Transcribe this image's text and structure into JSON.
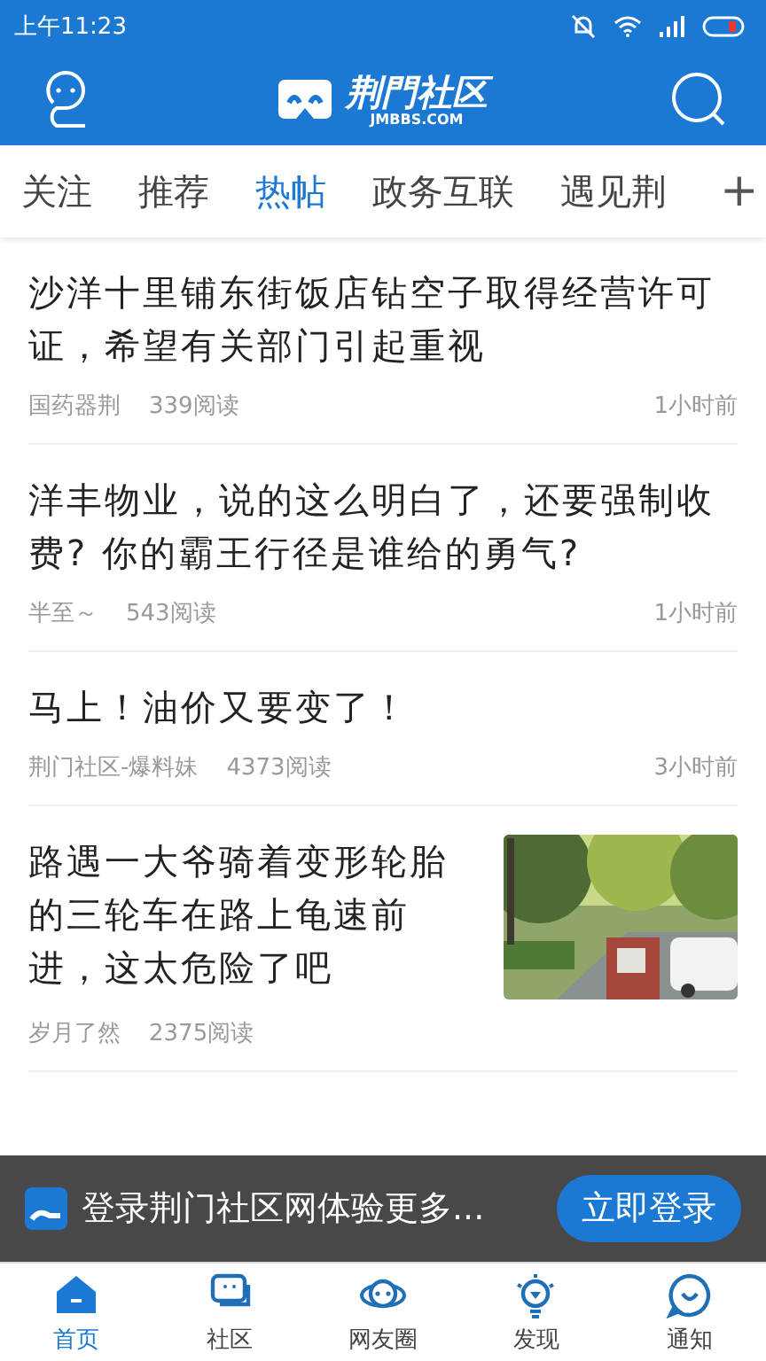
{
  "status_bar": {
    "time": "上午11:23"
  },
  "header": {
    "logo_title": "荆門社区",
    "logo_domain": "JMBBS.COM"
  },
  "tabs": [
    {
      "label": "关注",
      "selected": false
    },
    {
      "label": "推荐",
      "selected": false
    },
    {
      "label": "热帖",
      "selected": true
    },
    {
      "label": "政务互联",
      "selected": false
    },
    {
      "label": "遇见荆",
      "selected": false
    }
  ],
  "add_tab": "+",
  "posts": [
    {
      "kind": "text",
      "title": "沙洋十里铺东街饭店钻空子取得经营许可证，希望有关部门引起重视",
      "author": "国药器荆",
      "reads": "339阅读",
      "time": "1小时前"
    },
    {
      "kind": "text",
      "title": "洋丰物业，说的这么明白了，还要强制收费? 你的霸王行径是谁给的勇气?",
      "author": "半至～",
      "reads": "543阅读",
      "time": "1小时前"
    },
    {
      "kind": "text",
      "title": "马上！油价又要变了！",
      "author": "荆门社区-爆料妹",
      "reads": "4373阅读",
      "time": "3小时前"
    },
    {
      "title": "路遇一大爷骑着变形轮胎的三轮车在路上龟速前进，这太危险了吧",
      "author": "岁月了然",
      "reads": "2375阅读"
    }
  ],
  "login_banner": {
    "text": "登录荆门社区网体验更多...",
    "button": "立即登录"
  },
  "bottom_nav": [
    {
      "label": "首页",
      "selected": true
    },
    {
      "label": "社区",
      "selected": false
    },
    {
      "label": "网友圈",
      "selected": false
    },
    {
      "label": "发现",
      "selected": false
    },
    {
      "label": "通知",
      "selected": false
    }
  ]
}
